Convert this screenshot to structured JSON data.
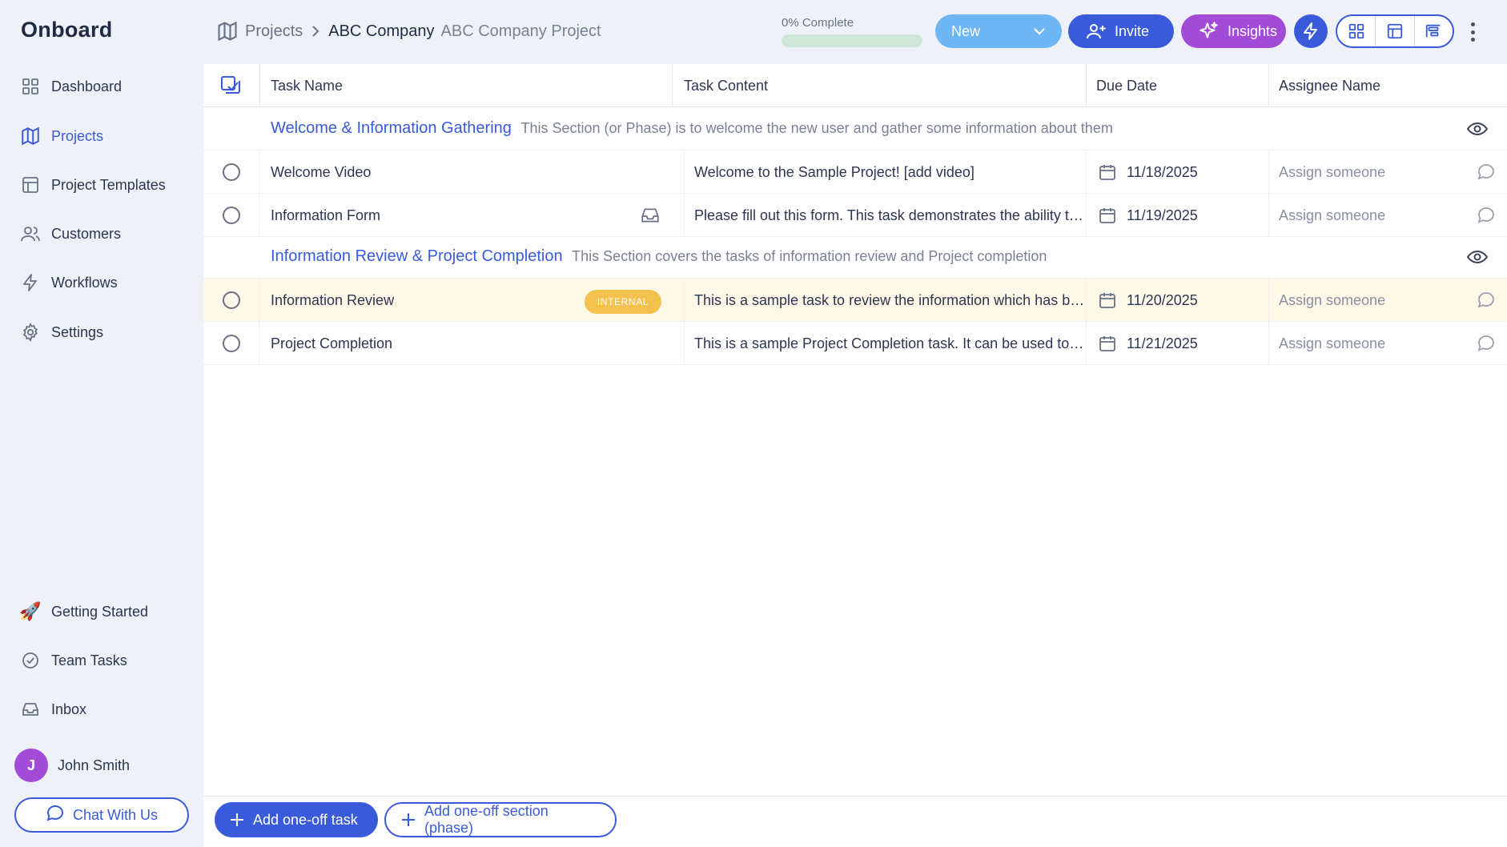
{
  "app": {
    "logo": "Onboard"
  },
  "sidebar": {
    "items": [
      {
        "label": "Dashboard",
        "icon": "dashboard-grid-icon"
      },
      {
        "label": "Projects",
        "icon": "map-icon",
        "active": true
      },
      {
        "label": "Project Templates",
        "icon": "template-icon"
      },
      {
        "label": "Customers",
        "icon": "users-icon"
      },
      {
        "label": "Workflows",
        "icon": "lightning-icon"
      },
      {
        "label": "Settings",
        "icon": "gear-icon"
      }
    ],
    "bottom_items": [
      {
        "label": "Getting Started",
        "icon": "rocket-icon"
      },
      {
        "label": "Team Tasks",
        "icon": "check-circle-icon"
      },
      {
        "label": "Inbox",
        "icon": "inbox-icon"
      }
    ],
    "user": {
      "initial": "J",
      "name": "John Smith"
    },
    "chat_label": "Chat With Us"
  },
  "header": {
    "breadcrumb_root": "Projects",
    "company": "ABC Company",
    "project": "ABC Company Project",
    "progress_label": "0% Complete",
    "progress_value": 0,
    "status": "New",
    "invite_label": "Invite",
    "insights_label": "Insights"
  },
  "table": {
    "columns": [
      "Task Name",
      "Task Content",
      "Due Date",
      "Assignee Name"
    ],
    "sections": [
      {
        "title": "Welcome & Information Gathering",
        "description": "This Section (or Phase) is to welcome the new user and gather some information about them",
        "tasks": [
          {
            "name": "Welcome Video",
            "content": "Welcome to the Sample Project! [add video]",
            "due": "11/18/2025",
            "assignee": "Assign someone"
          },
          {
            "name": "Information Form",
            "content": "Please fill out this form. This task demonstrates the ability to ...",
            "due": "11/19/2025",
            "assignee": "Assign someone"
          }
        ]
      },
      {
        "title": "Information Review & Project Completion",
        "description": "This Section covers the tasks of information review and Project completion",
        "tasks": [
          {
            "name": "Information Review",
            "badge": "INTERNAL",
            "content": "This is a sample task to review the information which has be...",
            "due": "11/20/2025",
            "assignee": "Assign someone"
          },
          {
            "name": "Project Completion",
            "content": "This is a sample Project Completion task. It can be used to o...",
            "due": "11/21/2025",
            "assignee": "Assign someone"
          }
        ]
      }
    ]
  },
  "footer": {
    "add_task": "Add one-off task",
    "add_section": "Add one-off section (phase)"
  },
  "colors": {
    "accent": "#3a5bd9",
    "insights": "#a14bd6",
    "status": "#6fb6f5",
    "badge": "#f2c14e"
  }
}
